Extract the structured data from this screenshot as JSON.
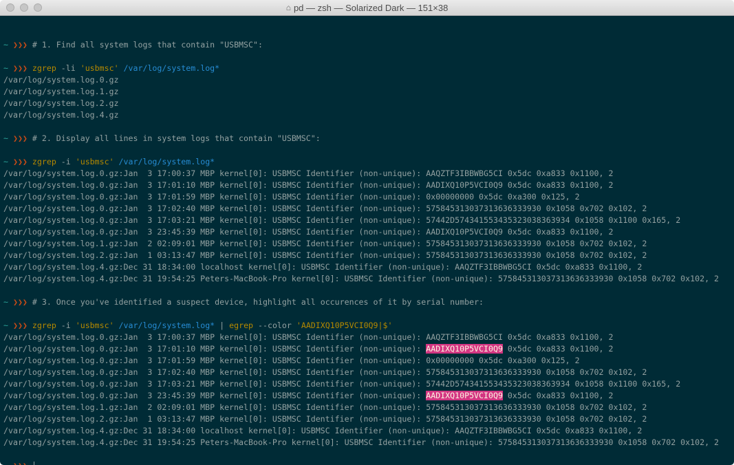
{
  "window": {
    "title": "pd — zsh — Solarized Dark — 151×38",
    "title_icon": "home-icon"
  },
  "colors": {
    "background": "#002b36",
    "text": "#93a1a1",
    "prompt_tilde": "#2aa198",
    "prompt_arrows": "#cb4b16",
    "command": "#b58900",
    "path": "#268bd2",
    "highlight": "#d33682"
  },
  "prompt": {
    "tilde": "~",
    "arrows": "❯❯❯"
  },
  "lines": [
    {
      "type": "blank"
    },
    {
      "type": "comment",
      "text": "# 1. Find all system logs that contain \"USBMSC\":"
    },
    {
      "type": "blank"
    },
    {
      "type": "command",
      "cmd": "zgrep",
      "opts": " -li ",
      "str": "'usbmsc'",
      "path": " /var/log/system.log*",
      "rest": ""
    },
    {
      "type": "output",
      "text": "/var/log/system.log.0.gz"
    },
    {
      "type": "output",
      "text": "/var/log/system.log.1.gz"
    },
    {
      "type": "output",
      "text": "/var/log/system.log.2.gz"
    },
    {
      "type": "output",
      "text": "/var/log/system.log.4.gz"
    },
    {
      "type": "blank"
    },
    {
      "type": "comment",
      "text": "# 2. Display all lines in system logs that contain \"USBMSC\":"
    },
    {
      "type": "blank"
    },
    {
      "type": "command",
      "cmd": "zgrep",
      "opts": " -i ",
      "str": "'usbmsc'",
      "path": " /var/log/system.log*",
      "rest": ""
    },
    {
      "type": "output",
      "text": "/var/log/system.log.0.gz:Jan  3 17:00:37 MBP kernel[0]: USBMSC Identifier (non-unique): AAQZTF3IBBWBG5CI 0x5dc 0xa833 0x1100, 2"
    },
    {
      "type": "output",
      "text": "/var/log/system.log.0.gz:Jan  3 17:01:10 MBP kernel[0]: USBMSC Identifier (non-unique): AADIXQ10P5VCI0Q9 0x5dc 0xa833 0x1100, 2"
    },
    {
      "type": "output",
      "text": "/var/log/system.log.0.gz:Jan  3 17:01:59 MBP kernel[0]: USBMSC Identifier (non-unique): 0x00000000 0x5dc 0xa300 0x125, 2"
    },
    {
      "type": "output",
      "text": "/var/log/system.log.0.gz:Jan  3 17:02:40 MBP kernel[0]: USBMSC Identifier (non-unique): 575845313037313636333930 0x1058 0x702 0x102, 2"
    },
    {
      "type": "output",
      "text": "/var/log/system.log.0.gz:Jan  3 17:03:21 MBP kernel[0]: USBMSC Identifier (non-unique): 57442D574341553435323038363934 0x1058 0x1100 0x165, 2"
    },
    {
      "type": "output",
      "text": "/var/log/system.log.0.gz:Jan  3 23:45:39 MBP kernel[0]: USBMSC Identifier (non-unique): AADIXQ10P5VCI0Q9 0x5dc 0xa833 0x1100, 2"
    },
    {
      "type": "output",
      "text": "/var/log/system.log.1.gz:Jan  2 02:09:01 MBP kernel[0]: USBMSC Identifier (non-unique): 575845313037313636333930 0x1058 0x702 0x102, 2"
    },
    {
      "type": "output",
      "text": "/var/log/system.log.2.gz:Jan  1 03:13:47 MBP kernel[0]: USBMSC Identifier (non-unique): 575845313037313636333930 0x1058 0x702 0x102, 2"
    },
    {
      "type": "output",
      "text": "/var/log/system.log.4.gz:Dec 31 18:34:00 localhost kernel[0]: USBMSC Identifier (non-unique): AAQZTF3IBBWBG5CI 0x5dc 0xa833 0x1100, 2"
    },
    {
      "type": "output",
      "text": "/var/log/system.log.4.gz:Dec 31 19:54:25 Peters-MacBook-Pro kernel[0]: USBMSC Identifier (non-unique): 575845313037313636333930 0x1058 0x702 0x102, 2"
    },
    {
      "type": "blank"
    },
    {
      "type": "comment",
      "text": "# 3. Once you've identified a suspect device, highlight all occurences of it by serial number:"
    },
    {
      "type": "blank"
    },
    {
      "type": "command",
      "cmd": "zgrep",
      "opts": " -i ",
      "str": "'usbmsc'",
      "path": " /var/log/system.log*",
      "rest": " | ",
      "cmd2": "egrep",
      "opts2": " --color ",
      "str2": "'AADIXQ10P5VCI0Q9|$'"
    },
    {
      "type": "output",
      "text": "/var/log/system.log.0.gz:Jan  3 17:00:37 MBP kernel[0]: USBMSC Identifier (non-unique): AAQZTF3IBBWBG5CI 0x5dc 0xa833 0x1100, 2"
    },
    {
      "type": "output_hl",
      "pre": "/var/log/system.log.0.gz:Jan  3 17:01:10 MBP kernel[0]: USBMSC Identifier (non-unique): ",
      "hl": "AADIXQ10P5VCI0Q9",
      "post": " 0x5dc 0xa833 0x1100, 2"
    },
    {
      "type": "output",
      "text": "/var/log/system.log.0.gz:Jan  3 17:01:59 MBP kernel[0]: USBMSC Identifier (non-unique): 0x00000000 0x5dc 0xa300 0x125, 2"
    },
    {
      "type": "output",
      "text": "/var/log/system.log.0.gz:Jan  3 17:02:40 MBP kernel[0]: USBMSC Identifier (non-unique): 575845313037313636333930 0x1058 0x702 0x102, 2"
    },
    {
      "type": "output",
      "text": "/var/log/system.log.0.gz:Jan  3 17:03:21 MBP kernel[0]: USBMSC Identifier (non-unique): 57442D574341553435323038363934 0x1058 0x1100 0x165, 2"
    },
    {
      "type": "output_hl",
      "pre": "/var/log/system.log.0.gz:Jan  3 23:45:39 MBP kernel[0]: USBMSC Identifier (non-unique): ",
      "hl": "AADIXQ10P5VCI0Q9",
      "post": " 0x5dc 0xa833 0x1100, 2"
    },
    {
      "type": "output",
      "text": "/var/log/system.log.1.gz:Jan  2 02:09:01 MBP kernel[0]: USBMSC Identifier (non-unique): 575845313037313636333930 0x1058 0x702 0x102, 2"
    },
    {
      "type": "output",
      "text": "/var/log/system.log.2.gz:Jan  1 03:13:47 MBP kernel[0]: USBMSC Identifier (non-unique): 575845313037313636333930 0x1058 0x702 0x102, 2"
    },
    {
      "type": "output",
      "text": "/var/log/system.log.4.gz:Dec 31 18:34:00 localhost kernel[0]: USBMSC Identifier (non-unique): AAQZTF3IBBWBG5CI 0x5dc 0xa833 0x1100, 2"
    },
    {
      "type": "output",
      "text": "/var/log/system.log.4.gz:Dec 31 19:54:25 Peters-MacBook-Pro kernel[0]: USBMSC Identifier (non-unique): 575845313037313636333930 0x1058 0x702 0x102, 2"
    },
    {
      "type": "blank"
    },
    {
      "type": "input_prompt"
    }
  ]
}
